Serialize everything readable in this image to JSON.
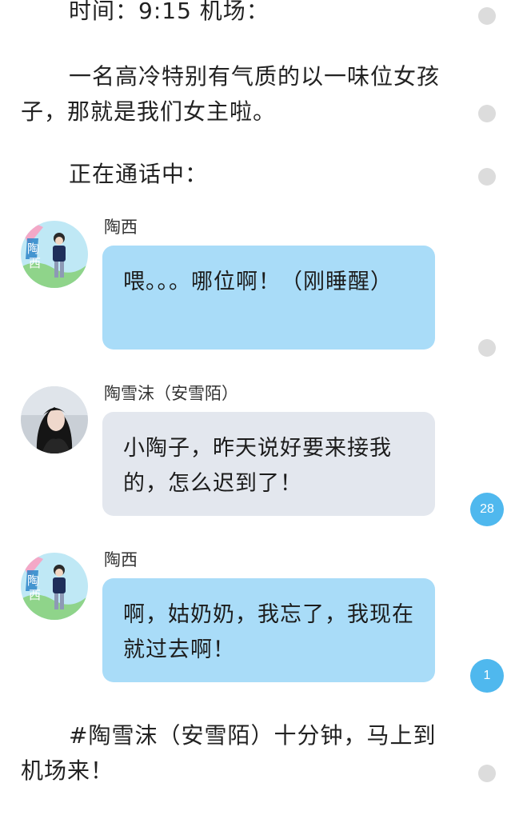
{
  "story": {
    "p1": "时间：9:15 机场：",
    "p2": "一名高冷特别有气质的以一味位女孩子，那就是我们女主啦。",
    "p3": "正在通话中：",
    "p4": "#陶雪沫（安雪陌）十分钟，马上到机场来！"
  },
  "chat": [
    {
      "speaker": "陶西",
      "message": "喂。。。哪位啊！（刚睡醒）",
      "bubble_color": "#a9dcf8"
    },
    {
      "speaker": "陶雪沫（安雪陌）",
      "message": "小陶子，昨天说好要来接我的，怎么迟到了！",
      "bubble_color": "#e3e7ee"
    },
    {
      "speaker": "陶西",
      "message": "啊，姑奶奶，我忘了，我现在就过去啊！",
      "bubble_color": "#a9dcf8"
    }
  ],
  "badges": {
    "comment_count_a": "28",
    "comment_count_b": "1"
  },
  "colors": {
    "badge": "#4fb8ee",
    "dot": "#dcdcdc"
  }
}
